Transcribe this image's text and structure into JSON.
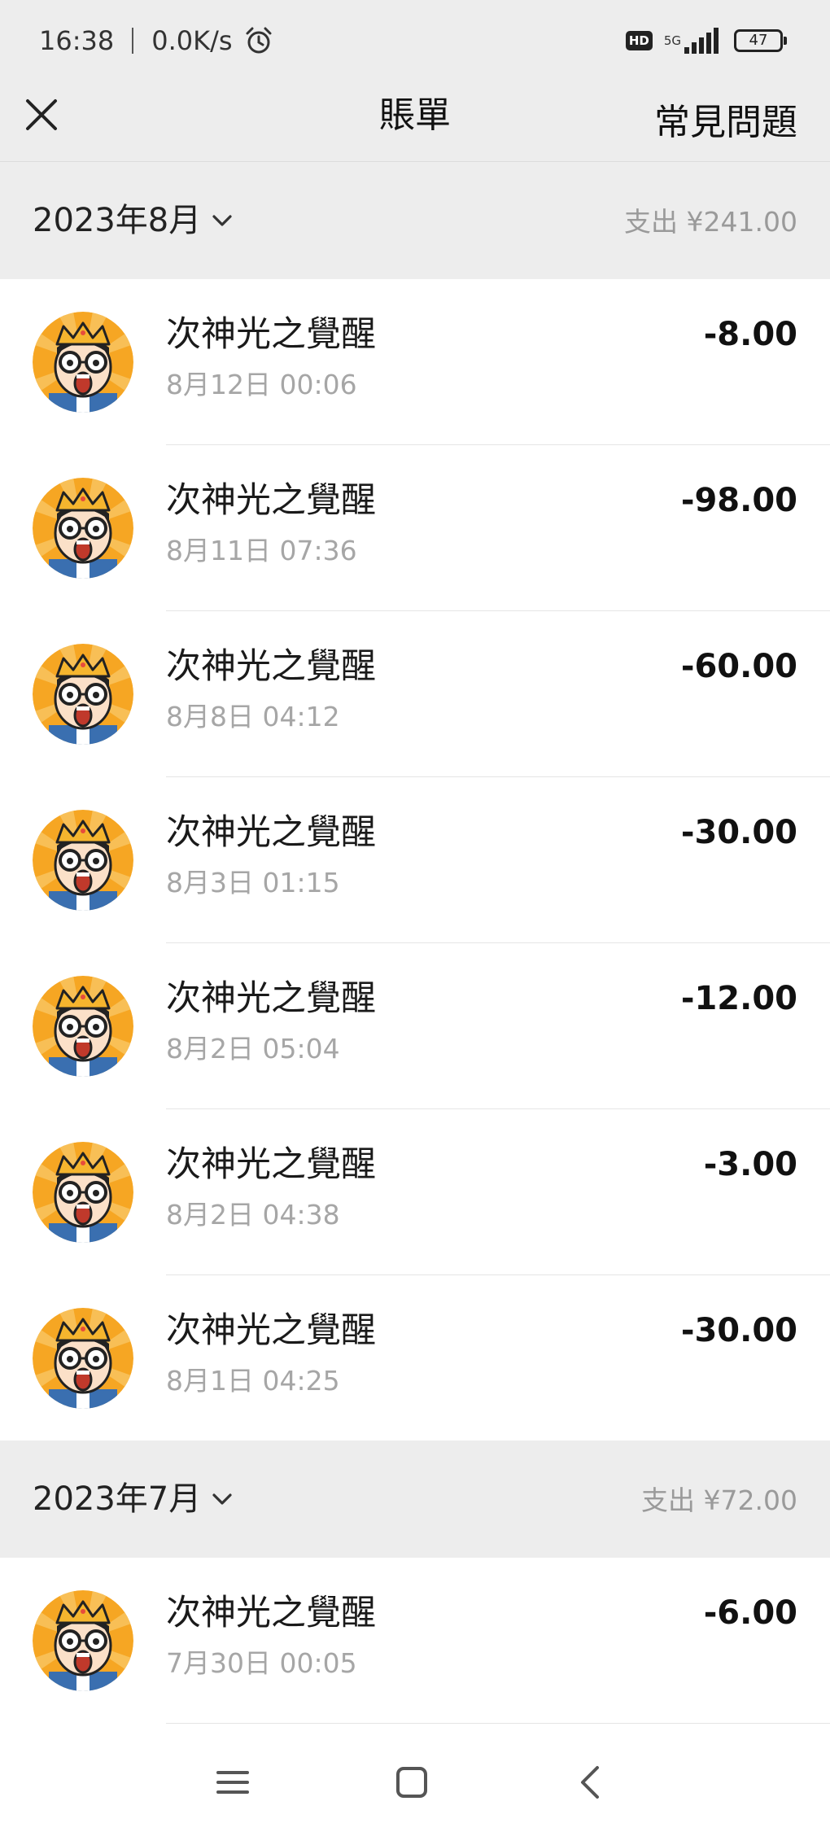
{
  "status_bar": {
    "time": "16:38",
    "speed": "0.0K/s",
    "hd_label": "HD",
    "network": "5G",
    "battery": "47"
  },
  "header": {
    "title": "賬單",
    "faq_label": "常見問題"
  },
  "icons": {
    "close": "close-icon",
    "chevron": "chevron-down-icon",
    "menu": "menu-icon",
    "home": "home-icon",
    "back": "back-icon",
    "avatar": "cartoon-king-avatar"
  },
  "colors": {
    "header_bg": "#ededed",
    "muted_text": "#a6a6a6",
    "avatar_bg": "#f6a623"
  },
  "months": [
    {
      "label": "2023年8月",
      "total": "支出 ¥241.00",
      "transactions": [
        {
          "name": "次神光之覺醒",
          "time": "8月12日  00:06",
          "amount": "-8.00"
        },
        {
          "name": "次神光之覺醒",
          "time": "8月11日  07:36",
          "amount": "-98.00"
        },
        {
          "name": "次神光之覺醒",
          "time": "8月8日  04:12",
          "amount": "-60.00"
        },
        {
          "name": "次神光之覺醒",
          "time": "8月3日  01:15",
          "amount": "-30.00"
        },
        {
          "name": "次神光之覺醒",
          "time": "8月2日  05:04",
          "amount": "-12.00"
        },
        {
          "name": "次神光之覺醒",
          "time": "8月2日  04:38",
          "amount": "-3.00"
        },
        {
          "name": "次神光之覺醒",
          "time": "8月1日  04:25",
          "amount": "-30.00"
        }
      ]
    },
    {
      "label": "2023年7月",
      "total": "支出 ¥72.00",
      "transactions": [
        {
          "name": "次神光之覺醒",
          "time": "7月30日  00:05",
          "amount": "-6.00"
        }
      ]
    }
  ]
}
